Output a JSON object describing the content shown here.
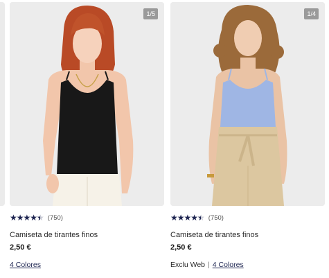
{
  "products": [
    {
      "counter": "1/5",
      "rating_count": "(750)",
      "name": "Camiseta de tirantes finos",
      "price": "2,50 €",
      "exclusive": "",
      "colors_link": "4 Colores",
      "photo": "woman-red-hair-black-camisole-white-jeans"
    },
    {
      "counter": "1/4",
      "rating_count": "(750)",
      "name": "Camiseta de tirantes finos",
      "price": "2,50 €",
      "exclusive": "Exclu Web",
      "separator": "|",
      "colors_link": "4 Colores",
      "photo": "woman-curly-hair-blue-camisole-beige-trousers"
    }
  ],
  "rating": {
    "value": 4.5,
    "max": 5
  },
  "colors": {
    "star": "#1f2652",
    "link": "#1f2652",
    "counter_bg": "#9a9a9a",
    "card_bg": "#ececec"
  }
}
